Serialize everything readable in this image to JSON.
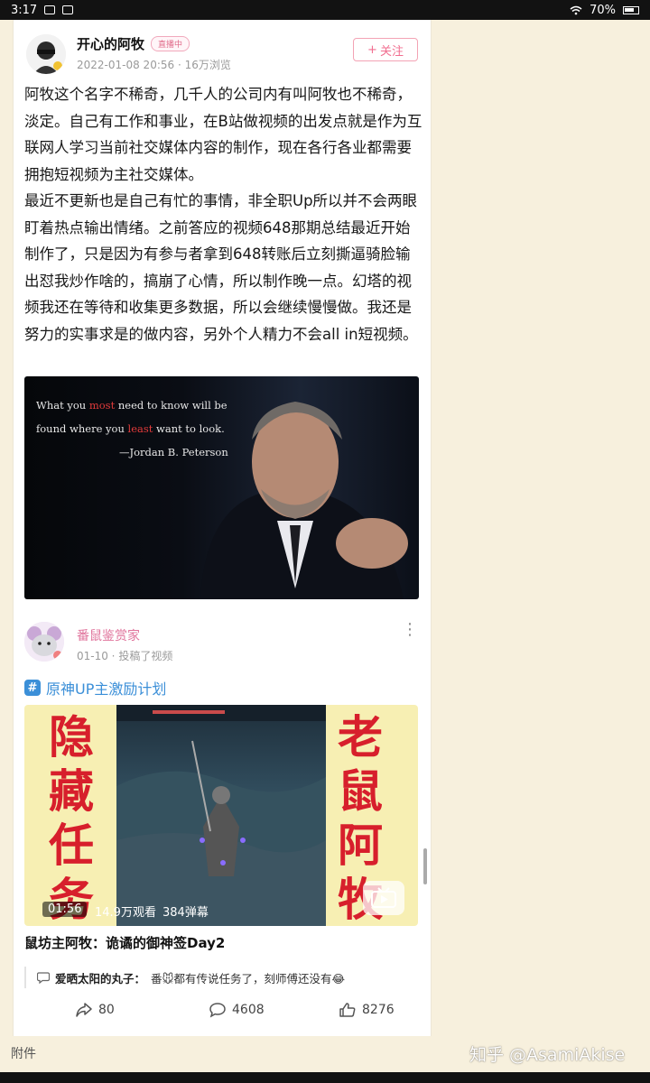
{
  "status_bar": {
    "time": "3:17",
    "battery": "70%"
  },
  "post": {
    "author": "开心的阿牧",
    "live_badge": "直播中",
    "meta": "2022-01-08 20:56 · 16万浏览",
    "follow_label": "关注",
    "paragraphs": [
      "阿牧这个名字不稀奇，几千人的公司内有叫阿牧也不稀奇，淡定。自己有工作和事业，在B站做视频的出发点就是作为互联网人学习当前社交媒体内容的制作，现在各行各业都需要拥抱短视频为主社交媒体。",
      "最近不更新也是自己有忙的事情，非全职Up所以并不会两眼盯着热点输出情绪。之前答应的视频648那期总结最近开始制作了，只是因为有参与者拿到648转账后立刻撕逼骑脸输出怼我炒作啥的，搞崩了心情，所以制作晚一点。幻塔的视频我还在等待和收集更多数据，所以会继续慢慢做。我还是努力的实事求是的做内容，另外个人精力不会all in短视频。"
    ],
    "quote_image": {
      "line1_a": "What you ",
      "line1_hl": "most",
      "line1_b": " need to know will be",
      "line2_a": "found where you ",
      "line2_hl": "least",
      "line2_b": " want to look.",
      "line3": "—Jordan B. Peterson"
    }
  },
  "video_post": {
    "author": "番鼠鉴赏家",
    "meta": "01-10 · 投稿了视频",
    "topic": "原神UP主激励计划",
    "thumb_left_text": [
      "隐",
      "藏",
      "任",
      "务"
    ],
    "thumb_right_text": [
      "老",
      "鼠",
      "阿",
      "牧"
    ],
    "duration": "01:56",
    "views": "14.9万观看",
    "danmaku": "384弹幕",
    "title": "鼠坊主阿牧：诡谲的御神签Day2",
    "comment_user": "爱晒太阳的丸子：",
    "comment_text": "番🐭都有传说任务了，刻师傅还没有😂",
    "share_count": "80",
    "comment_count": "4608",
    "like_count": "8276"
  },
  "footer": {
    "attachment_label": "附件",
    "watermark": "知乎 @AsamiAkise"
  },
  "colors": {
    "accent_pink": "#f16d8f",
    "topic_blue": "#3b8fd8",
    "page_bg": "#f7f0dd"
  }
}
